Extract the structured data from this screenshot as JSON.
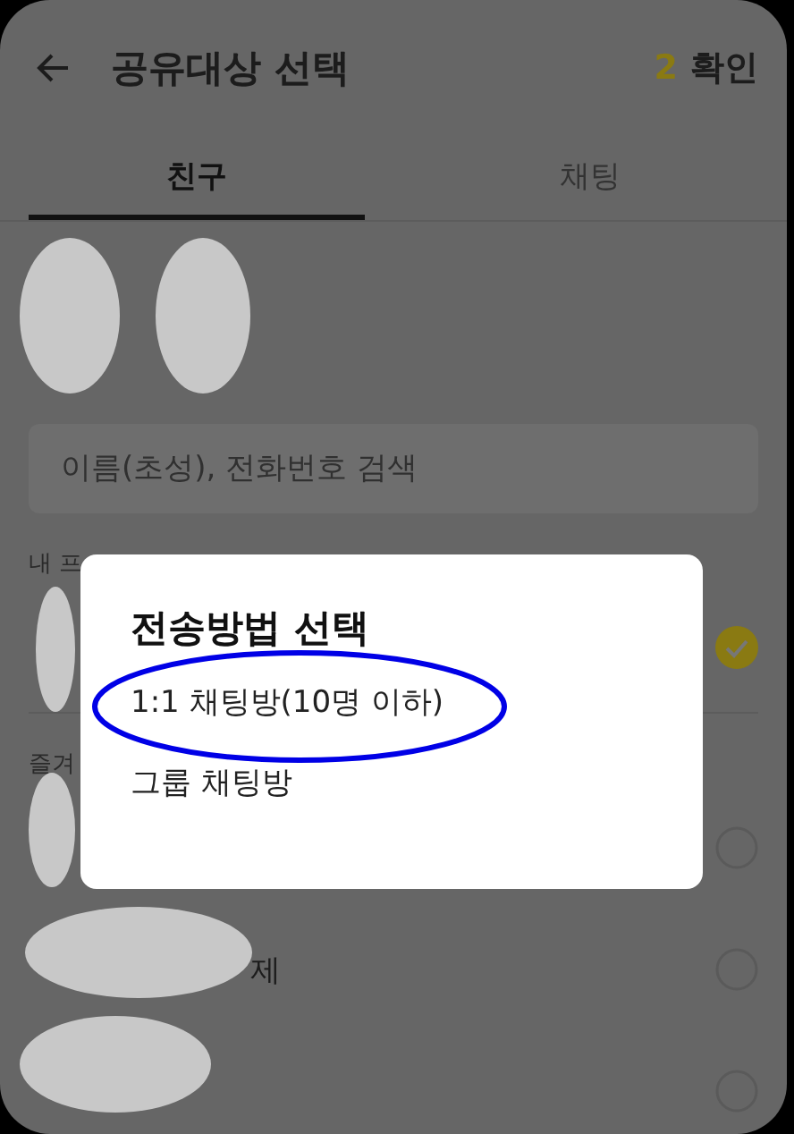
{
  "header": {
    "title": "공유대상 선택",
    "count": "2",
    "confirm": "확인"
  },
  "tabs": [
    {
      "label": "친구",
      "selected": true
    },
    {
      "label": "채팅",
      "selected": false
    }
  ],
  "search": {
    "placeholder": "이름(초성), 전화번호 검색"
  },
  "sections": [
    {
      "label": "내 프",
      "rows": [
        {
          "checked": true
        }
      ]
    },
    {
      "label": "즐겨",
      "rows": [
        {
          "checked": false
        },
        {
          "name": "제",
          "checked": false
        },
        {
          "checked": false
        }
      ]
    }
  ],
  "dialog": {
    "title": "전송방법 선택",
    "options": [
      {
        "label": "1:1 채팅방(10명 이하)",
        "highlighted": true
      },
      {
        "label": "그룹 채팅방",
        "highlighted": false
      }
    ]
  }
}
